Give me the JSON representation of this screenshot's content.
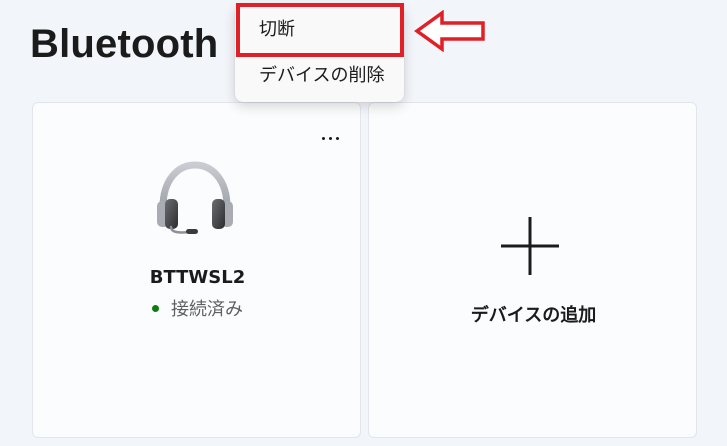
{
  "header": {
    "title": "Bluetooth"
  },
  "device_card": {
    "name": "BTTWSL2",
    "status": "接続済み",
    "status_color": "#107c10",
    "icon": "headset-icon",
    "more_icon": "more-options-icon"
  },
  "add_card": {
    "label": "デバイスの追加",
    "icon": "plus-icon"
  },
  "context_menu": {
    "items": [
      {
        "label": "切断"
      },
      {
        "label": "デバイスの削除"
      }
    ]
  },
  "annotation": {
    "highlight_color": "#e01f26",
    "arrow_icon": "left-arrow-icon"
  }
}
